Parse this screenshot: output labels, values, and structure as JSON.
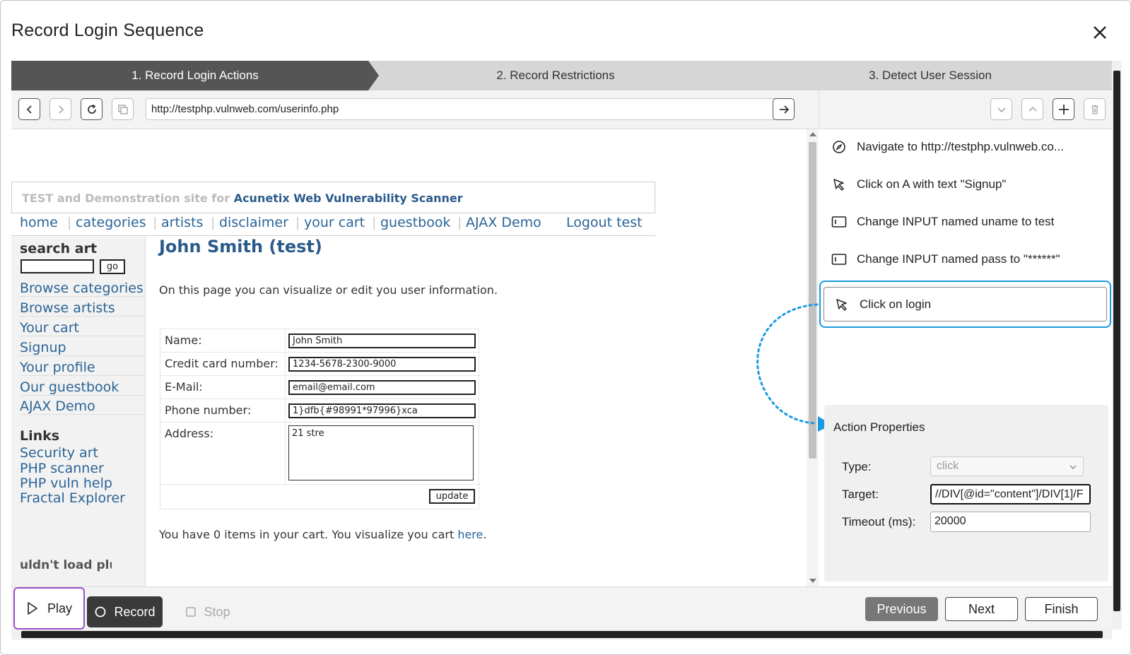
{
  "dialog": {
    "title": "Record Login Sequence"
  },
  "steps": [
    {
      "label": "1. Record Login Actions"
    },
    {
      "label": "2. Record Restrictions"
    },
    {
      "label": "3. Detect User Session"
    }
  ],
  "browser": {
    "url": "http://testphp.vulnweb.com/userinfo.php"
  },
  "site": {
    "banner_prefix": "TEST and Demonstration site for ",
    "banner_brand": "Acunetix Web Vulnerability Scanner",
    "nav": [
      "home",
      "categories",
      "artists",
      "disclaimer",
      "your cart",
      "guestbook",
      "AJAX Demo"
    ],
    "logout": "Logout test",
    "sidebar": {
      "search_title": "search art",
      "go": "go",
      "links": [
        "Browse categories",
        "Browse artists",
        "Your cart",
        "Signup",
        "Your profile",
        "Our guestbook",
        "AJAX Demo"
      ],
      "links_title": "Links",
      "links2": [
        "Security art",
        "PHP scanner",
        "PHP vuln help",
        "Fractal Explorer"
      ],
      "plugin": "uldn't load pluc"
    },
    "heading": "John Smith (test)",
    "intro": "On this page you can visualize or edit you user information.",
    "form": {
      "name_label": "Name:",
      "name_value": "John Smith",
      "cc_label": "Credit card number:",
      "cc_value": "1234-5678-2300-9000",
      "email_label": "E-Mail:",
      "email_value": "email@email.com",
      "phone_label": "Phone number:",
      "phone_value": "1}dfb{#98991*97996}xca",
      "address_label": "Address:",
      "address_value": "21 stre",
      "update": "update"
    },
    "cart_text": "You have 0 items in your cart. You visualize you cart ",
    "cart_link": "here",
    "cart_end": "."
  },
  "actions": [
    {
      "icon": "compass-icon",
      "label": "Navigate to http://testphp.vulnweb.co..."
    },
    {
      "icon": "cursor-icon",
      "label": "Click on A with text \"Signup\""
    },
    {
      "icon": "input-field-icon",
      "label": "Change INPUT named uname to test"
    },
    {
      "icon": "input-field-icon",
      "label": "Change INPUT named pass to \"******\""
    },
    {
      "icon": "cursor-icon",
      "label": "Click on login"
    }
  ],
  "properties": {
    "title": "Action Properties",
    "type_label": "Type:",
    "type_value": "click",
    "target_label": "Target:",
    "target_value": "//DIV[@id=\"content\"]/DIV[1]/F",
    "timeout_label": "Timeout (ms):",
    "timeout_value": "20000"
  },
  "bottom": {
    "play": "Play",
    "record": "Record",
    "stop": "Stop",
    "previous": "Previous",
    "next": "Next",
    "finish": "Finish"
  },
  "colors": {
    "accent_selected": "#1a9be0",
    "play_outline": "#9c4fc9",
    "active_step": "#555555",
    "link": "#2a6496"
  }
}
